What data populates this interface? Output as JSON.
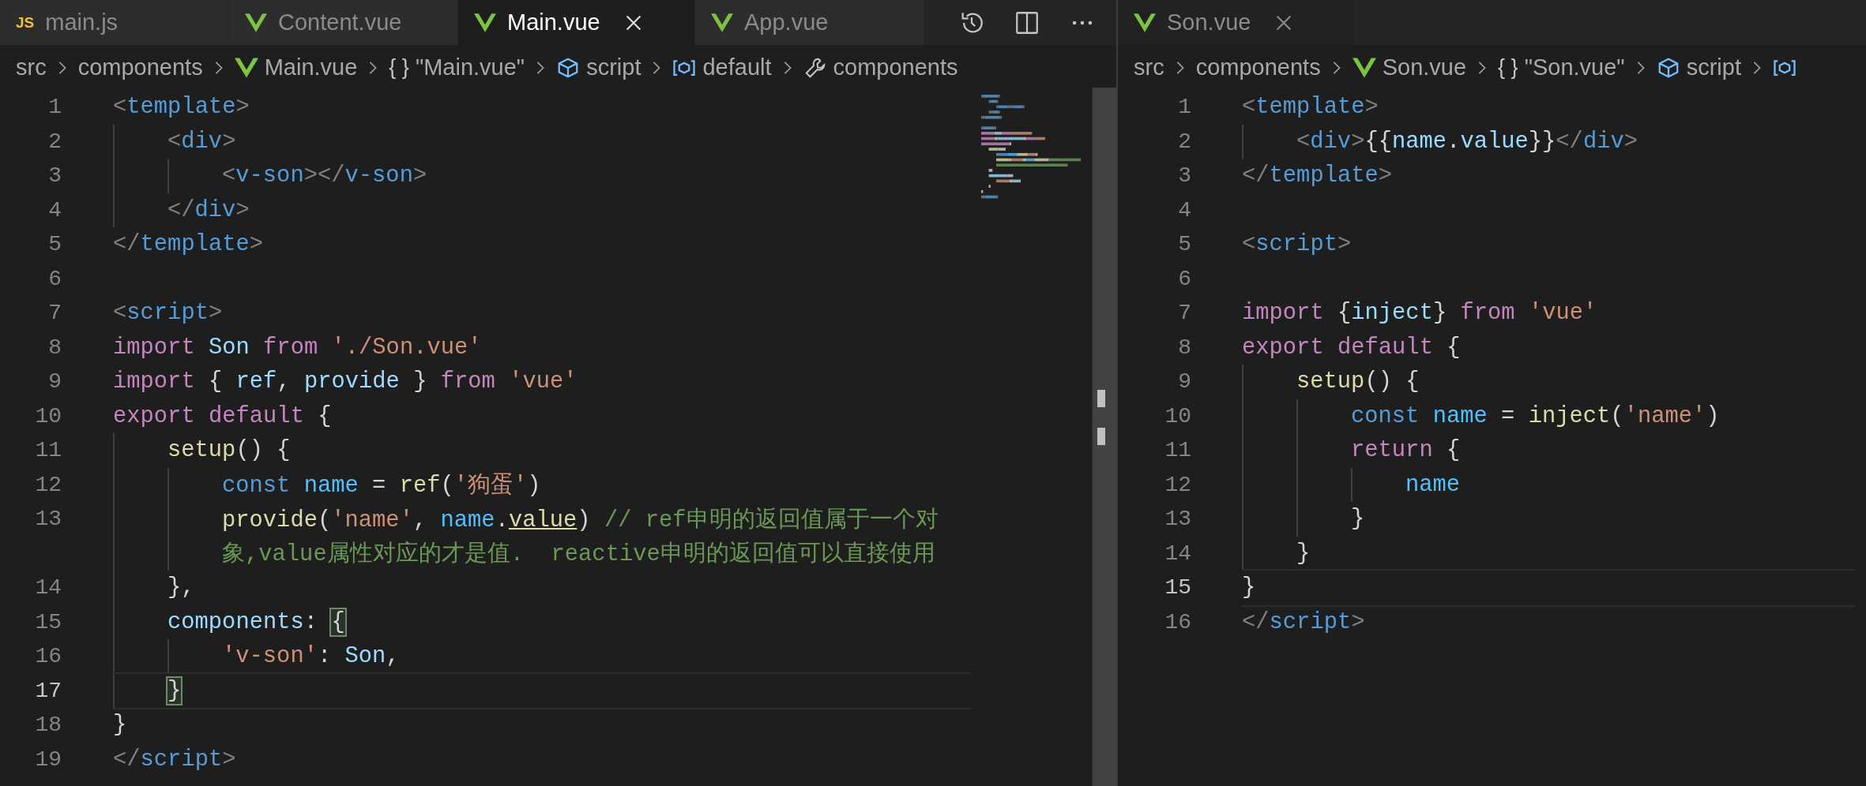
{
  "groups": [
    {
      "focused": true,
      "tabs": [
        {
          "label": "main.js",
          "kind": "js",
          "badge": "JS",
          "selected": false
        },
        {
          "label": "Content.vue",
          "kind": "vue",
          "selected": false
        },
        {
          "label": "Main.vue",
          "kind": "vue",
          "selected": true
        },
        {
          "label": "App.vue",
          "kind": "vue",
          "selected": false
        }
      ],
      "actions": [
        {
          "kind": "history"
        },
        {
          "kind": "split"
        },
        {
          "kind": "more"
        }
      ],
      "breadcrumbs": [
        {
          "label": "src",
          "kind": "folder"
        },
        {
          "label": "components",
          "kind": "folder"
        },
        {
          "label": "Main.vue",
          "kind": "vue"
        },
        {
          "label": "\"Main.vue\"",
          "kind": "braces",
          "glyph": "{ }"
        },
        {
          "label": "script",
          "kind": "module"
        },
        {
          "label": "default",
          "kind": "symbol"
        },
        {
          "label": "components",
          "kind": "wrench"
        }
      ],
      "minimap": true,
      "lines": [
        {
          "number": "1",
          "current": false,
          "tokens": [
            {
              "kind": "punct",
              "text": "<"
            },
            {
              "kind": "tag",
              "text": "template"
            },
            {
              "kind": "punct",
              "text": ">"
            }
          ],
          "children": [
            {
              "number": "2",
              "current": false,
              "tokens": [
                {
                  "kind": "punct",
                  "text": "<"
                },
                {
                  "kind": "tag",
                  "text": "div"
                },
                {
                  "kind": "punct",
                  "text": ">"
                }
              ],
              "children": [
                {
                  "number": "3",
                  "current": false,
                  "tokens": [
                    {
                      "kind": "punct",
                      "text": "<"
                    },
                    {
                      "kind": "tag",
                      "text": "v-son"
                    },
                    {
                      "kind": "punct",
                      "text": "></"
                    },
                    {
                      "kind": "tag",
                      "text": "v-son"
                    },
                    {
                      "kind": "punct",
                      "text": ">"
                    }
                  ]
                }
              ]
            },
            {
              "number": "4",
              "current": false,
              "tokens": [
                {
                  "kind": "punct",
                  "text": "</"
                },
                {
                  "kind": "tag",
                  "text": "div"
                },
                {
                  "kind": "punct",
                  "text": ">"
                }
              ]
            }
          ]
        },
        {
          "number": "5",
          "current": false,
          "tokens": [
            {
              "kind": "punct",
              "text": "</"
            },
            {
              "kind": "tag",
              "text": "template"
            },
            {
              "kind": "punct",
              "text": ">"
            }
          ]
        },
        {
          "number": "6",
          "current": false
        },
        {
          "number": "7",
          "current": false,
          "tokens": [
            {
              "kind": "punct",
              "text": "<"
            },
            {
              "kind": "tag",
              "text": "script"
            },
            {
              "kind": "punct",
              "text": ">"
            }
          ]
        },
        {
          "number": "8",
          "current": false,
          "tokens": [
            {
              "kind": "keyword",
              "text": "import "
            },
            {
              "kind": "var",
              "text": "Son "
            },
            {
              "kind": "keyword",
              "text": "from "
            },
            {
              "kind": "string",
              "text": "'./Son.vue'"
            }
          ]
        },
        {
          "number": "9",
          "current": false,
          "tokens": [
            {
              "kind": "keyword",
              "text": "import "
            },
            {
              "kind": "text",
              "text": "{ "
            },
            {
              "kind": "var",
              "text": "ref"
            },
            {
              "kind": "text",
              "text": ", "
            },
            {
              "kind": "var",
              "text": "provide "
            },
            {
              "kind": "text",
              "text": "} "
            },
            {
              "kind": "keyword",
              "text": "from "
            },
            {
              "kind": "string",
              "text": "'vue'"
            }
          ]
        },
        {
          "number": "10",
          "current": false,
          "tokens": [
            {
              "kind": "keyword",
              "text": "export default "
            },
            {
              "kind": "text",
              "text": "{"
            }
          ],
          "children": [
            {
              "number": "11",
              "current": false,
              "tokens": [
                {
                  "kind": "func",
                  "text": "setup"
                },
                {
                  "kind": "text",
                  "text": "() {"
                }
              ],
              "children": [
                {
                  "number": "12",
                  "current": false,
                  "tokens": [
                    {
                      "kind": "storage",
                      "text": "const "
                    },
                    {
                      "kind": "const",
                      "text": "name "
                    },
                    {
                      "kind": "text",
                      "text": "= "
                    },
                    {
                      "kind": "func",
                      "text": "ref"
                    },
                    {
                      "kind": "text",
                      "text": "("
                    },
                    {
                      "kind": "string",
                      "text": "'狗蛋'"
                    },
                    {
                      "kind": "text",
                      "text": ")"
                    }
                  ]
                },
                {
                  "number": "13",
                  "current": false,
                  "tokens": [
                    {
                      "kind": "func",
                      "text": "provide"
                    },
                    {
                      "kind": "text",
                      "text": "("
                    },
                    {
                      "kind": "string",
                      "text": "'name'"
                    },
                    {
                      "kind": "text",
                      "text": ", "
                    },
                    {
                      "kind": "const",
                      "text": "name"
                    },
                    {
                      "kind": "text",
                      "text": "."
                    },
                    {
                      "kind": "underline",
                      "text": "value"
                    },
                    {
                      "kind": "text",
                      "text": ") "
                    },
                    {
                      "kind": "comment",
                      "text": "// ref申明的返回值属于一个对"
                    }
                  ],
                  "wrap": [
                    {
                      "kind": "comment",
                      "text": "象,value属性对应的才是值.  reactive申明的返回值可以直接使用"
                    }
                  ]
                }
              ]
            },
            {
              "number": "14",
              "current": false,
              "tokens": [
                {
                  "kind": "text",
                  "text": "},"
                }
              ]
            },
            {
              "number": "15",
              "current": false,
              "tokens": [
                {
                  "kind": "var",
                  "text": "components"
                },
                {
                  "kind": "text",
                  "text": ": "
                },
                {
                  "kind": "match",
                  "text": "{"
                }
              ],
              "children": [
                {
                  "number": "16",
                  "current": false,
                  "tokens": [
                    {
                      "kind": "string",
                      "text": "'v-son'"
                    },
                    {
                      "kind": "text",
                      "text": ": "
                    },
                    {
                      "kind": "var",
                      "text": "Son"
                    },
                    {
                      "kind": "text",
                      "text": ","
                    }
                  ]
                }
              ]
            },
            {
              "number": "17",
              "current": true,
              "tokens": [
                {
                  "kind": "match",
                  "text": "}"
                }
              ]
            }
          ]
        },
        {
          "number": "18",
          "current": false,
          "tokens": [
            {
              "kind": "text",
              "text": "}"
            }
          ]
        },
        {
          "number": "19",
          "current": false,
          "tokens": [
            {
              "kind": "punct",
              "text": "</"
            },
            {
              "kind": "tag",
              "text": "script"
            },
            {
              "kind": "punct",
              "text": ">"
            }
          ]
        }
      ]
    },
    {
      "focused": false,
      "tabs": [
        {
          "label": "Son.vue",
          "kind": "vue",
          "selected": true
        }
      ],
      "breadcrumbs": [
        {
          "label": "src",
          "kind": "folder"
        },
        {
          "label": "components",
          "kind": "folder"
        },
        {
          "label": "Son.vue",
          "kind": "vue"
        },
        {
          "label": "\"Son.vue\"",
          "kind": "braces",
          "glyph": "{ }"
        },
        {
          "label": "script",
          "kind": "module"
        },
        {
          "kind": "symbol"
        }
      ],
      "lines": [
        {
          "number": "1",
          "current": false,
          "tokens": [
            {
              "kind": "punct",
              "text": "<"
            },
            {
              "kind": "tag",
              "text": "template"
            },
            {
              "kind": "punct",
              "text": ">"
            }
          ],
          "children": [
            {
              "number": "2",
              "current": false,
              "tokens": [
                {
                  "kind": "punct",
                  "text": "<"
                },
                {
                  "kind": "tag",
                  "text": "div"
                },
                {
                  "kind": "punct",
                  "text": ">"
                },
                {
                  "kind": "text",
                  "text": "{{"
                },
                {
                  "kind": "var",
                  "text": "name"
                },
                {
                  "kind": "text",
                  "text": "."
                },
                {
                  "kind": "var",
                  "text": "value"
                },
                {
                  "kind": "text",
                  "text": "}}"
                },
                {
                  "kind": "punct",
                  "text": "</"
                },
                {
                  "kind": "tag",
                  "text": "div"
                },
                {
                  "kind": "punct",
                  "text": ">"
                }
              ]
            }
          ]
        },
        {
          "number": "3",
          "current": false,
          "tokens": [
            {
              "kind": "punct",
              "text": "</"
            },
            {
              "kind": "tag",
              "text": "template"
            },
            {
              "kind": "punct",
              "text": ">"
            }
          ]
        },
        {
          "number": "4",
          "current": false
        },
        {
          "number": "5",
          "current": false,
          "tokens": [
            {
              "kind": "punct",
              "text": "<"
            },
            {
              "kind": "tag",
              "text": "script"
            },
            {
              "kind": "punct",
              "text": ">"
            }
          ]
        },
        {
          "number": "6",
          "current": false
        },
        {
          "number": "7",
          "current": false,
          "tokens": [
            {
              "kind": "keyword",
              "text": "import "
            },
            {
              "kind": "text",
              "text": "{"
            },
            {
              "kind": "var",
              "text": "inject"
            },
            {
              "kind": "text",
              "text": "} "
            },
            {
              "kind": "keyword",
              "text": "from "
            },
            {
              "kind": "string",
              "text": "'vue'"
            }
          ]
        },
        {
          "number": "8",
          "current": false,
          "tokens": [
            {
              "kind": "keyword",
              "text": "export default "
            },
            {
              "kind": "text",
              "text": "{"
            }
          ],
          "children": [
            {
              "number": "9",
              "current": false,
              "tokens": [
                {
                  "kind": "func",
                  "text": "setup"
                },
                {
                  "kind": "text",
                  "text": "() {"
                }
              ],
              "children": [
                {
                  "number": "10",
                  "current": false,
                  "tokens": [
                    {
                      "kind": "storage",
                      "text": "const "
                    },
                    {
                      "kind": "const",
                      "text": "name "
                    },
                    {
                      "kind": "text",
                      "text": "= "
                    },
                    {
                      "kind": "func",
                      "text": "inject"
                    },
                    {
                      "kind": "text",
                      "text": "("
                    },
                    {
                      "kind": "string",
                      "text": "'name'"
                    },
                    {
                      "kind": "text",
                      "text": ")"
                    }
                  ]
                },
                {
                  "number": "11",
                  "current": false,
                  "tokens": [
                    {
                      "kind": "keyword",
                      "text": "return "
                    },
                    {
                      "kind": "text",
                      "text": "{"
                    }
                  ],
                  "children": [
                    {
                      "number": "12",
                      "current": false,
                      "tokens": [
                        {
                          "kind": "const",
                          "text": "name"
                        }
                      ]
                    }
                  ]
                },
                {
                  "number": "13",
                  "current": false,
                  "tokens": [
                    {
                      "kind": "text",
                      "text": "}"
                    }
                  ]
                }
              ]
            },
            {
              "number": "14",
              "current": false,
              "tokens": [
                {
                  "kind": "text",
                  "text": "}"
                }
              ]
            }
          ]
        },
        {
          "number": "15",
          "current": true,
          "tokens": [
            {
              "kind": "text",
              "text": "}"
            }
          ]
        },
        {
          "number": "16",
          "current": false,
          "tokens": [
            {
              "kind": "punct",
              "text": "</"
            },
            {
              "kind": "tag",
              "text": "script"
            },
            {
              "kind": "punct",
              "text": ">"
            }
          ]
        }
      ]
    }
  ]
}
